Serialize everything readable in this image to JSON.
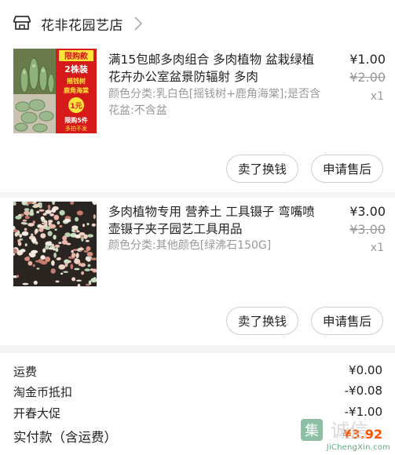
{
  "shop": {
    "name": "花非花园艺店",
    "icon": "shop-icon",
    "chevron": "chevron-right-icon"
  },
  "items": [
    {
      "title": "满15包邮多肉组合 多肉植物 盆栽绿植花卉办公室盆景防辐射 多肉",
      "sku": "颜色分类:乳白色[摇钱树+鹿角海棠];是否含花盆:不含盆",
      "price": "¥1.00",
      "original_price": "¥2.00",
      "quantity": "x1",
      "buttons": [
        "卖了换钱",
        "申请售后"
      ],
      "thumbnail": {
        "badge_top": "限购款",
        "badge_mid": "2株装",
        "tag1": "摇钱树",
        "tag2": "鹿角海棠",
        "price_tag": "1元",
        "bottom1": "限购5件",
        "bottom2": "多拍不发"
      }
    },
    {
      "title": "多肉植物专用 营养土 工具镊子 弯嘴喷壶镊子夹子园艺工具用品",
      "sku": "颜色分类:其他颜色[绿沸石150G]",
      "price": "¥3.00",
      "original_price": "¥3.00",
      "quantity": "x1",
      "buttons": [
        "卖了换钱",
        "申请售后"
      ]
    }
  ],
  "summary": {
    "freight_label": "运费",
    "freight_value": "¥0.00",
    "coin_label": "淘金币抵扣",
    "coin_value": "-¥0.08",
    "promo_label": "开春大促",
    "promo_value": "-¥1.00",
    "total_label": "实付款（含运费）",
    "total_value": "¥3.92"
  },
  "watermark": {
    "mark": "集",
    "text": "诚信",
    "url": "JiChengXin.com"
  },
  "colors": {
    "accent": "#ff5000",
    "muted": "#999999",
    "background": "#f4f4f4"
  }
}
